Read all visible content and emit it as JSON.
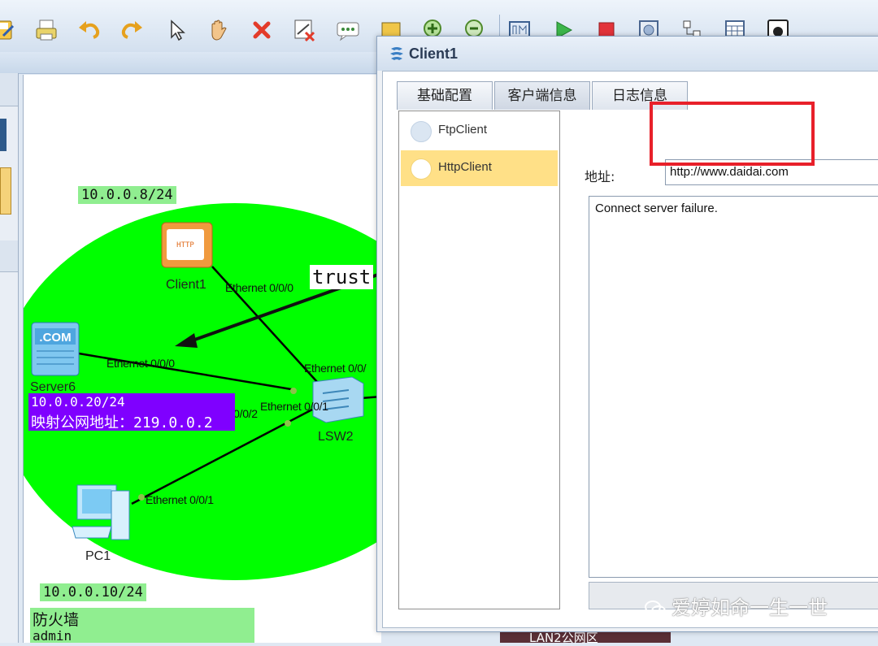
{
  "toolbar": {
    "buttons": [
      "save-as",
      "print",
      "undo",
      "redo",
      "select",
      "pan",
      "delete",
      "delete-link",
      "text-note",
      "rectangle",
      "zoom-in",
      "zoom-reset",
      "custom",
      "start",
      "stop",
      "capture",
      "topology",
      "palette",
      "console"
    ]
  },
  "topology": {
    "ip_labels": {
      "top": "10.0.0.8/24",
      "bottom": "10.0.0.10/24"
    },
    "zone_label": "trust",
    "nodes": {
      "client": "Client1",
      "server": "Server6",
      "switch": "LSW2",
      "pc": "PC1"
    },
    "ports": {
      "client_eth": "Ethernet 0/0/0",
      "server_eth": "Ethernet 0/0/0",
      "switch_top": "Ethernet 0/0/",
      "switch_left": "Ethernet 0/0/2",
      "switch_mid": "Ethernet 0/0/1",
      "pc_eth": "Ethernet 0/0/1"
    },
    "server_info": {
      "ip": "10.0.0.20/24",
      "mapped": "映射公网地址：219.0.0.2"
    },
    "firewall_info": {
      "name": "防火墙",
      "user": "admin"
    },
    "device_icons": {
      "client_icon_text": "HTTP",
      "server_icon_text": ".COM"
    }
  },
  "dialog": {
    "title": "Client1",
    "tabs": [
      "基础配置",
      "客户端信息",
      "日志信息"
    ],
    "clients": [
      {
        "name": "FtpClient",
        "selected": false
      },
      {
        "name": "HttpClient",
        "selected": true
      }
    ],
    "address_label": "地址:",
    "url_value": "http://www.daidai.com",
    "response_text": "Connect server failure."
  },
  "watermark": "爱婷如命一生一世",
  "background_fragment": "LAN2公网区",
  "colors": {
    "zone_green": "#00ff00",
    "label_green": "#90ee90",
    "server_box": "#7f00ff",
    "highlight_red": "#e8202a",
    "selected_item": "#ffe087"
  }
}
